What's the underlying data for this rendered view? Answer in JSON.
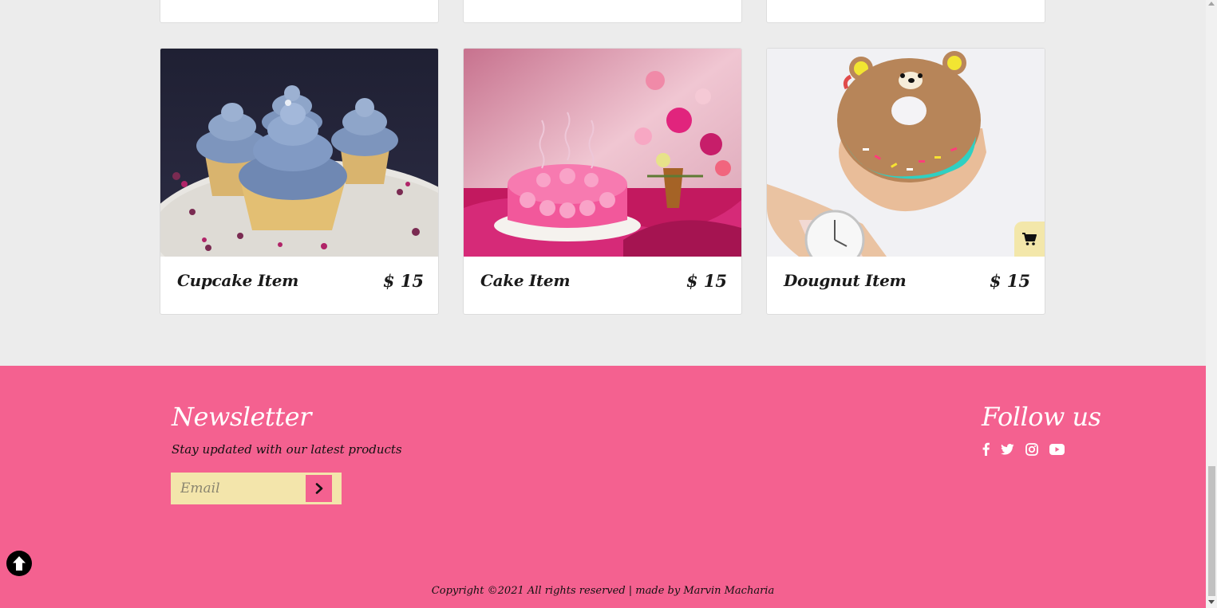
{
  "products": [
    {
      "name": "Cupcake Item",
      "price": "$ 15",
      "image": "cupcake-photo"
    },
    {
      "name": "Cake Item",
      "price": "$ 15",
      "image": "cake-photo"
    },
    {
      "name": "Dougnut Item",
      "price": "$ 15",
      "image": "doughnut-photo",
      "cart_icon": "cart-icon"
    }
  ],
  "newsletter": {
    "title": "Newsletter",
    "subtitle": "Stay updated with our latest products",
    "email_placeholder": "Email",
    "submit_icon": "chevron-right-icon"
  },
  "follow": {
    "title": "Follow us",
    "icons": [
      "facebook-icon",
      "twitter-icon",
      "instagram-icon",
      "youtube-icon"
    ]
  },
  "copyright": "Copyright ©2021 All rights reserved | made by Marvin Macharia",
  "colors": {
    "footer_bg": "#f46190",
    "page_bg": "#ececec",
    "accent_yellow": "#f3e5ab"
  }
}
